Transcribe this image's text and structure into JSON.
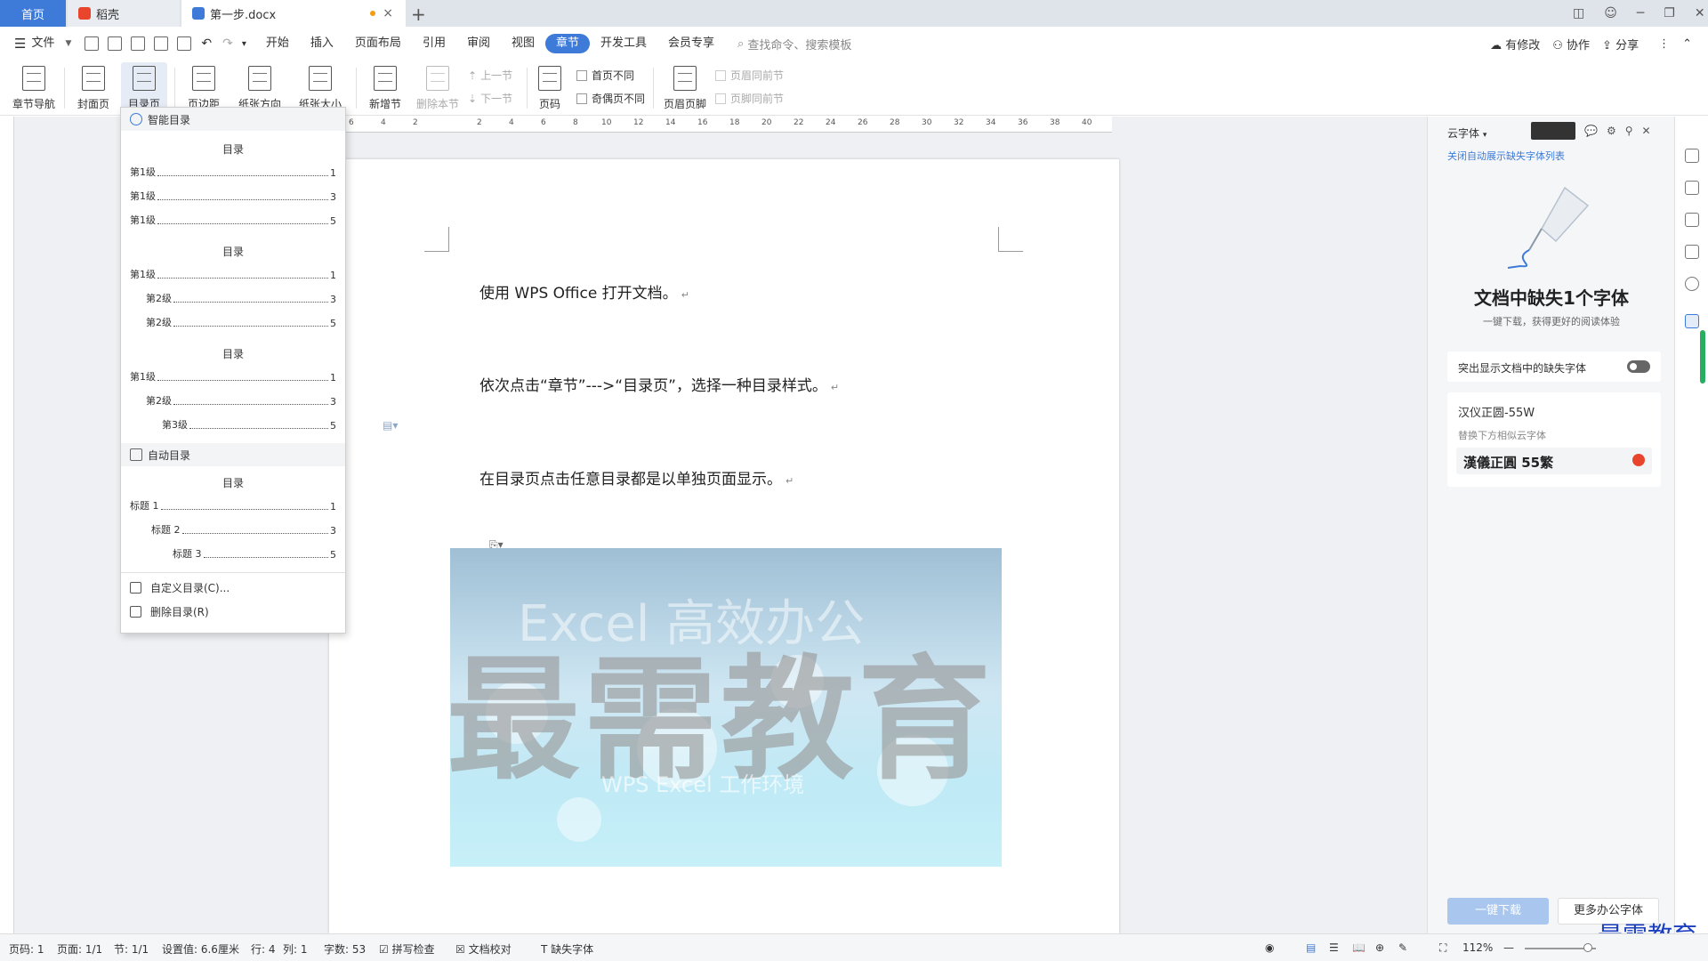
{
  "tabs": {
    "home": "首页",
    "daoke": "稻壳",
    "document": "第一步.docx"
  },
  "menu": {
    "file": "文件",
    "items": [
      "开始",
      "插入",
      "页面布局",
      "引用",
      "审阅",
      "视图",
      "章节",
      "开发工具",
      "会员专享"
    ],
    "active": "章节",
    "search_placeholder": "查找命令、搜索模板",
    "right": {
      "changes": "有修改",
      "collab": "协作",
      "share": "分享"
    }
  },
  "ribbon": {
    "chapter_nav": "章节导航",
    "cover": "封面页",
    "toc": "目录页",
    "margins": "页边距",
    "orientation": "纸张方向",
    "size": "纸张大小",
    "new_section": "新增节",
    "delete_section": "删除本节",
    "prev_section": "上一节",
    "next_section": "下一节",
    "page_number": "页码",
    "first_page_diff": "首页不同",
    "odd_even_diff": "奇偶页不同",
    "header_footer": "页眉页脚",
    "header_same": "页眉同前节",
    "footer_same": "页脚同前节"
  },
  "dropdown": {
    "smart_toc": "智能目录",
    "auto_toc": "自动目录",
    "toc_title": "目录",
    "custom": "自定义目录(C)...",
    "delete": "删除目录(R)",
    "style1": [
      {
        "label": "第1级",
        "page": "1"
      },
      {
        "label": "第1级",
        "page": "3"
      },
      {
        "label": "第1级",
        "page": "5"
      }
    ],
    "style2": [
      {
        "label": "第1级",
        "page": "1"
      },
      {
        "label": "第2级",
        "page": "3"
      },
      {
        "label": "第2级",
        "page": "5"
      }
    ],
    "style3": [
      {
        "label": "第1级",
        "page": "1"
      },
      {
        "label": "第2级",
        "page": "3"
      },
      {
        "label": "第3级",
        "page": "5"
      }
    ],
    "auto": [
      {
        "label": "标题 1",
        "page": "1"
      },
      {
        "label": "标题 2",
        "page": "3"
      },
      {
        "label": "标题 3",
        "page": "5"
      }
    ]
  },
  "document": {
    "p1": "使用 WPS Office 打开文档。",
    "p2": "依次点击“章节”--->“目录页”，选择一种目录样式。",
    "p3": "在目录页点击任意目录都是以单独页面显示。",
    "image_text_top": "Excel 高效办公",
    "image_watermark": "最需教育",
    "image_text_sub": "WPS Excel 工作环境"
  },
  "ruler_numbers": [
    "6",
    "4",
    "2",
    "2",
    "4",
    "6",
    "8",
    "10",
    "12",
    "14",
    "16",
    "18",
    "20",
    "22",
    "24",
    "26",
    "28",
    "30",
    "32",
    "34",
    "36",
    "38",
    "40"
  ],
  "panel": {
    "title": "云字体",
    "hide_link": "关闭自动展示缺失字体列表",
    "headline": "文档中缺失1个字体",
    "subline": "一键下载，获得更好的阅读体验",
    "highlight_label": "突出显示文档中的缺失字体",
    "font_name": "汉仪正圆-55W",
    "replace_hint": "替换下方相似云字体",
    "similar_font": "漢儀正圓 55繁",
    "download_btn": "一键下载",
    "more_btn": "更多办公字体"
  },
  "status": {
    "page": "页码: 1",
    "pages": "页面: 1/1",
    "section": "节: 1/1",
    "setting": "设置值: 6.6厘米",
    "row": "行: 4",
    "col": "列: 1",
    "words": "字数: 53",
    "spell": "拼写检查",
    "proof": "文档校对",
    "missing_font": "缺失字体",
    "zoom": "112%"
  },
  "watermark_corner": "最需教育",
  "colors": {
    "accent": "#3e7bd8",
    "tab_bar": "#dfe3ea",
    "workspace": "#eef0f3"
  }
}
